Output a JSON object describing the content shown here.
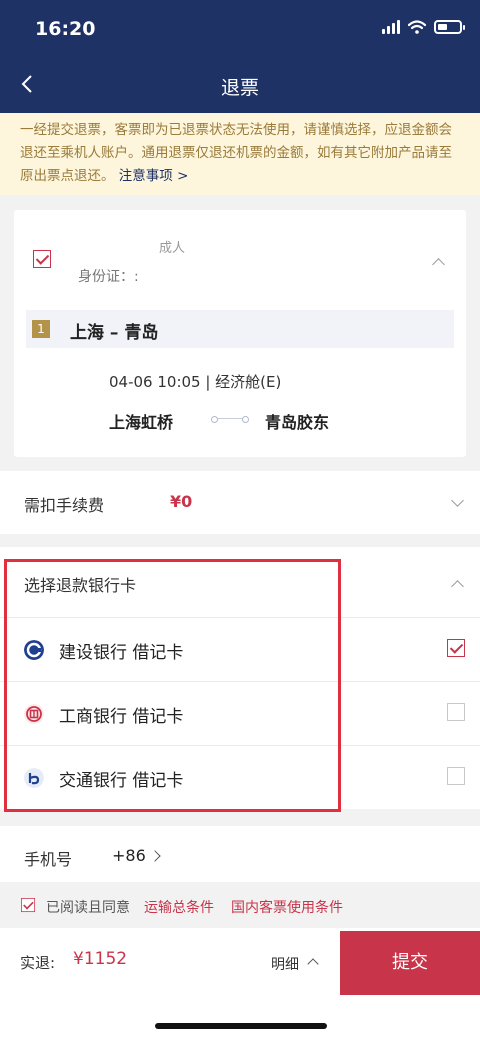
{
  "status_bar": {
    "time": "16:20"
  },
  "nav": {
    "title": "退票"
  },
  "notice": {
    "text": "一经提交退票，客票即为已退票状态无法使用，请谨慎选择，应退金额会退还至乘机人账户。通用退票仅退还机票的金额，如有其它附加产品请至原出票点退还。",
    "link": "注意事项 >"
  },
  "passenger": {
    "type": "成人",
    "id_label": "身份证：:",
    "checked": true,
    "route": {
      "number": "1",
      "name": "上海 – 青岛",
      "flight_info": "04-06 10:05 | 经济舱(E)",
      "from": "上海虹桥",
      "to": "青岛胶东"
    }
  },
  "fee": {
    "label": "需扣手续费",
    "value": "¥0"
  },
  "bank": {
    "title": "选择退款银行卡",
    "cards": [
      {
        "name": "建设银行 借记卡",
        "logo": "ccb-logo-icon",
        "checked": true
      },
      {
        "name": "工商银行 借记卡",
        "logo": "icbc-logo-icon",
        "checked": false
      },
      {
        "name": "交通银行 借记卡",
        "logo": "bocom-logo-icon",
        "checked": false
      }
    ]
  },
  "phone": {
    "label": "手机号",
    "value": "+86"
  },
  "agree": {
    "text": "已阅读且同意",
    "link1": "运输总条件",
    "link2": "国内客票使用条件",
    "checked": true
  },
  "bottom": {
    "refund_label": "实退:",
    "refund_value": "¥1152",
    "detail": "明细",
    "submit": "提交"
  },
  "colors": {
    "header_bg": "#1f3266",
    "accent_red": "#c8344a",
    "notice_bg": "#fdf5dc",
    "notice_text": "#9a7b3a",
    "route_badge": "#b39249",
    "highlight_border": "#e0303f"
  }
}
